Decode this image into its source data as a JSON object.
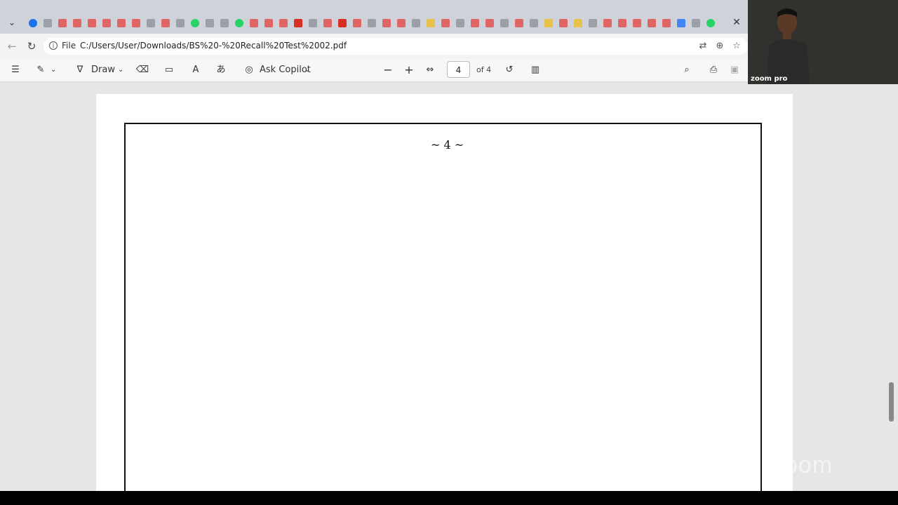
{
  "browser": {
    "tab_menu_icon": "chevron-down-icon",
    "tab_favicons": [
      "#1a73e8",
      "#9aa0a6",
      "#e06666",
      "#e06666",
      "#e06666",
      "#e06666",
      "#e06666",
      "#e06666",
      "#9aa0a6",
      "#e06666",
      "#9aa0a6",
      "#25d366",
      "#9aa0a6",
      "#9aa0a6",
      "#25d366",
      "#e06666",
      "#e06666",
      "#e06666",
      "#d93025",
      "#9aa0a6",
      "#e06666",
      "#d93025",
      "#e06666",
      "#9aa0a6",
      "#e06666",
      "#e06666",
      "#9aa0a6",
      "#e8c24a",
      "#e06666",
      "#9aa0a6",
      "#e06666",
      "#e06666",
      "#9aa0a6",
      "#e06666",
      "#9aa0a6",
      "#e8c24a",
      "#e06666",
      "#e8c24a",
      "#9aa0a6",
      "#e06666",
      "#e06666",
      "#e06666",
      "#e06666",
      "#e06666",
      "#4285f4",
      "#9aa0a6",
      "#25d366"
    ],
    "file_label": "File",
    "url": "C:/Users/User/Downloads/BS%20-%20Recall%20Test%2002.pdf"
  },
  "pdf_toolbar": {
    "draw_label": "Draw",
    "copilot_label": "Ask Copilot",
    "page_current": "4",
    "page_total": "of 4"
  },
  "document": {
    "page_marker": "~ 4 ~"
  },
  "zoom": {
    "label": "zoom pro",
    "watermark": "zoom"
  },
  "colors": {
    "accent_red": "#cc1f1f",
    "page_border": "#111111"
  }
}
